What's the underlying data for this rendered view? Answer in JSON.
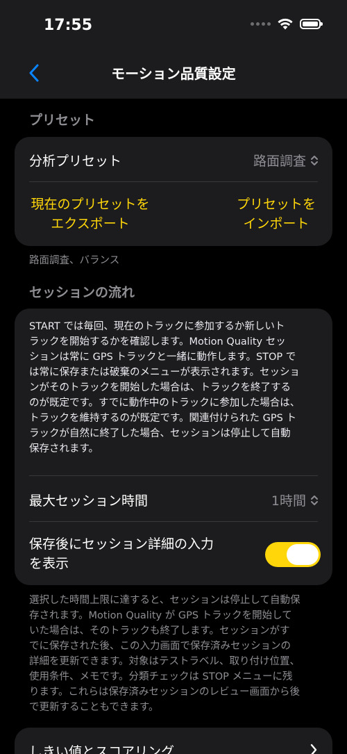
{
  "status_bar": {
    "time": "17:55"
  },
  "nav": {
    "title": "モーション品質設定"
  },
  "preset_section": {
    "header": "プリセット",
    "row_label": "分析プリセット",
    "row_value": "路面調査",
    "export_label_line1": "現在のプリセットを",
    "export_label_line2": "エクスポート",
    "import_label_line1": "プリセットを",
    "import_label_line2": "インポート",
    "footnote": "路面調査、バランス"
  },
  "session_section": {
    "header": "セッションの流れ",
    "description_lines": [
      "START では毎回、現在のトラックに参加するか新しいト",
      "ラックを開始するかを確認します。Motion Quality セッ",
      "ションは常に GPS トラックと一緒に動作します。STOP で",
      "は常に保存または破棄のメニューが表示されます。セッショ",
      "ンがそのトラックを開始した場合は、トラックを終了する",
      "のが既定です。すでに動作中のトラックに参加した場合は、",
      "トラックを維持するのが既定です。関連付けられた GPS ト",
      "ラックが自然に終了した場合、セッションは停止して自動",
      "保存されます。"
    ],
    "max_session_label": "最大セッション時間",
    "max_session_value": "1時間",
    "toggle_label_line1": "保存後にセッション詳細の入力",
    "toggle_label_line2": "を表示",
    "toggle_on": true,
    "footnote_lines": [
      "選択した時間上限に達すると、セッションは停止して自動保",
      "存されます。Motion Quality が GPS トラックを開始して",
      "いた場合は、そのトラックも終了します。セッションがす",
      "でに保存された後、この入力画面で保存済みセッションの",
      "詳細を更新できます。対象はテストラベル、取り付け位置、",
      "使用条件、メモです。分類チェックは STOP メニューに残",
      "ります。これらは保存済みセッションのレビュー画面から後",
      "で更新することもできます。"
    ]
  },
  "threshold_row": {
    "label": "しきい値とスコアリング"
  },
  "colors": {
    "accent": "#ffd60a",
    "link_blue": "#0a84ff",
    "card_bg": "#1c1c1e",
    "secondary_text": "#8e8e93"
  }
}
